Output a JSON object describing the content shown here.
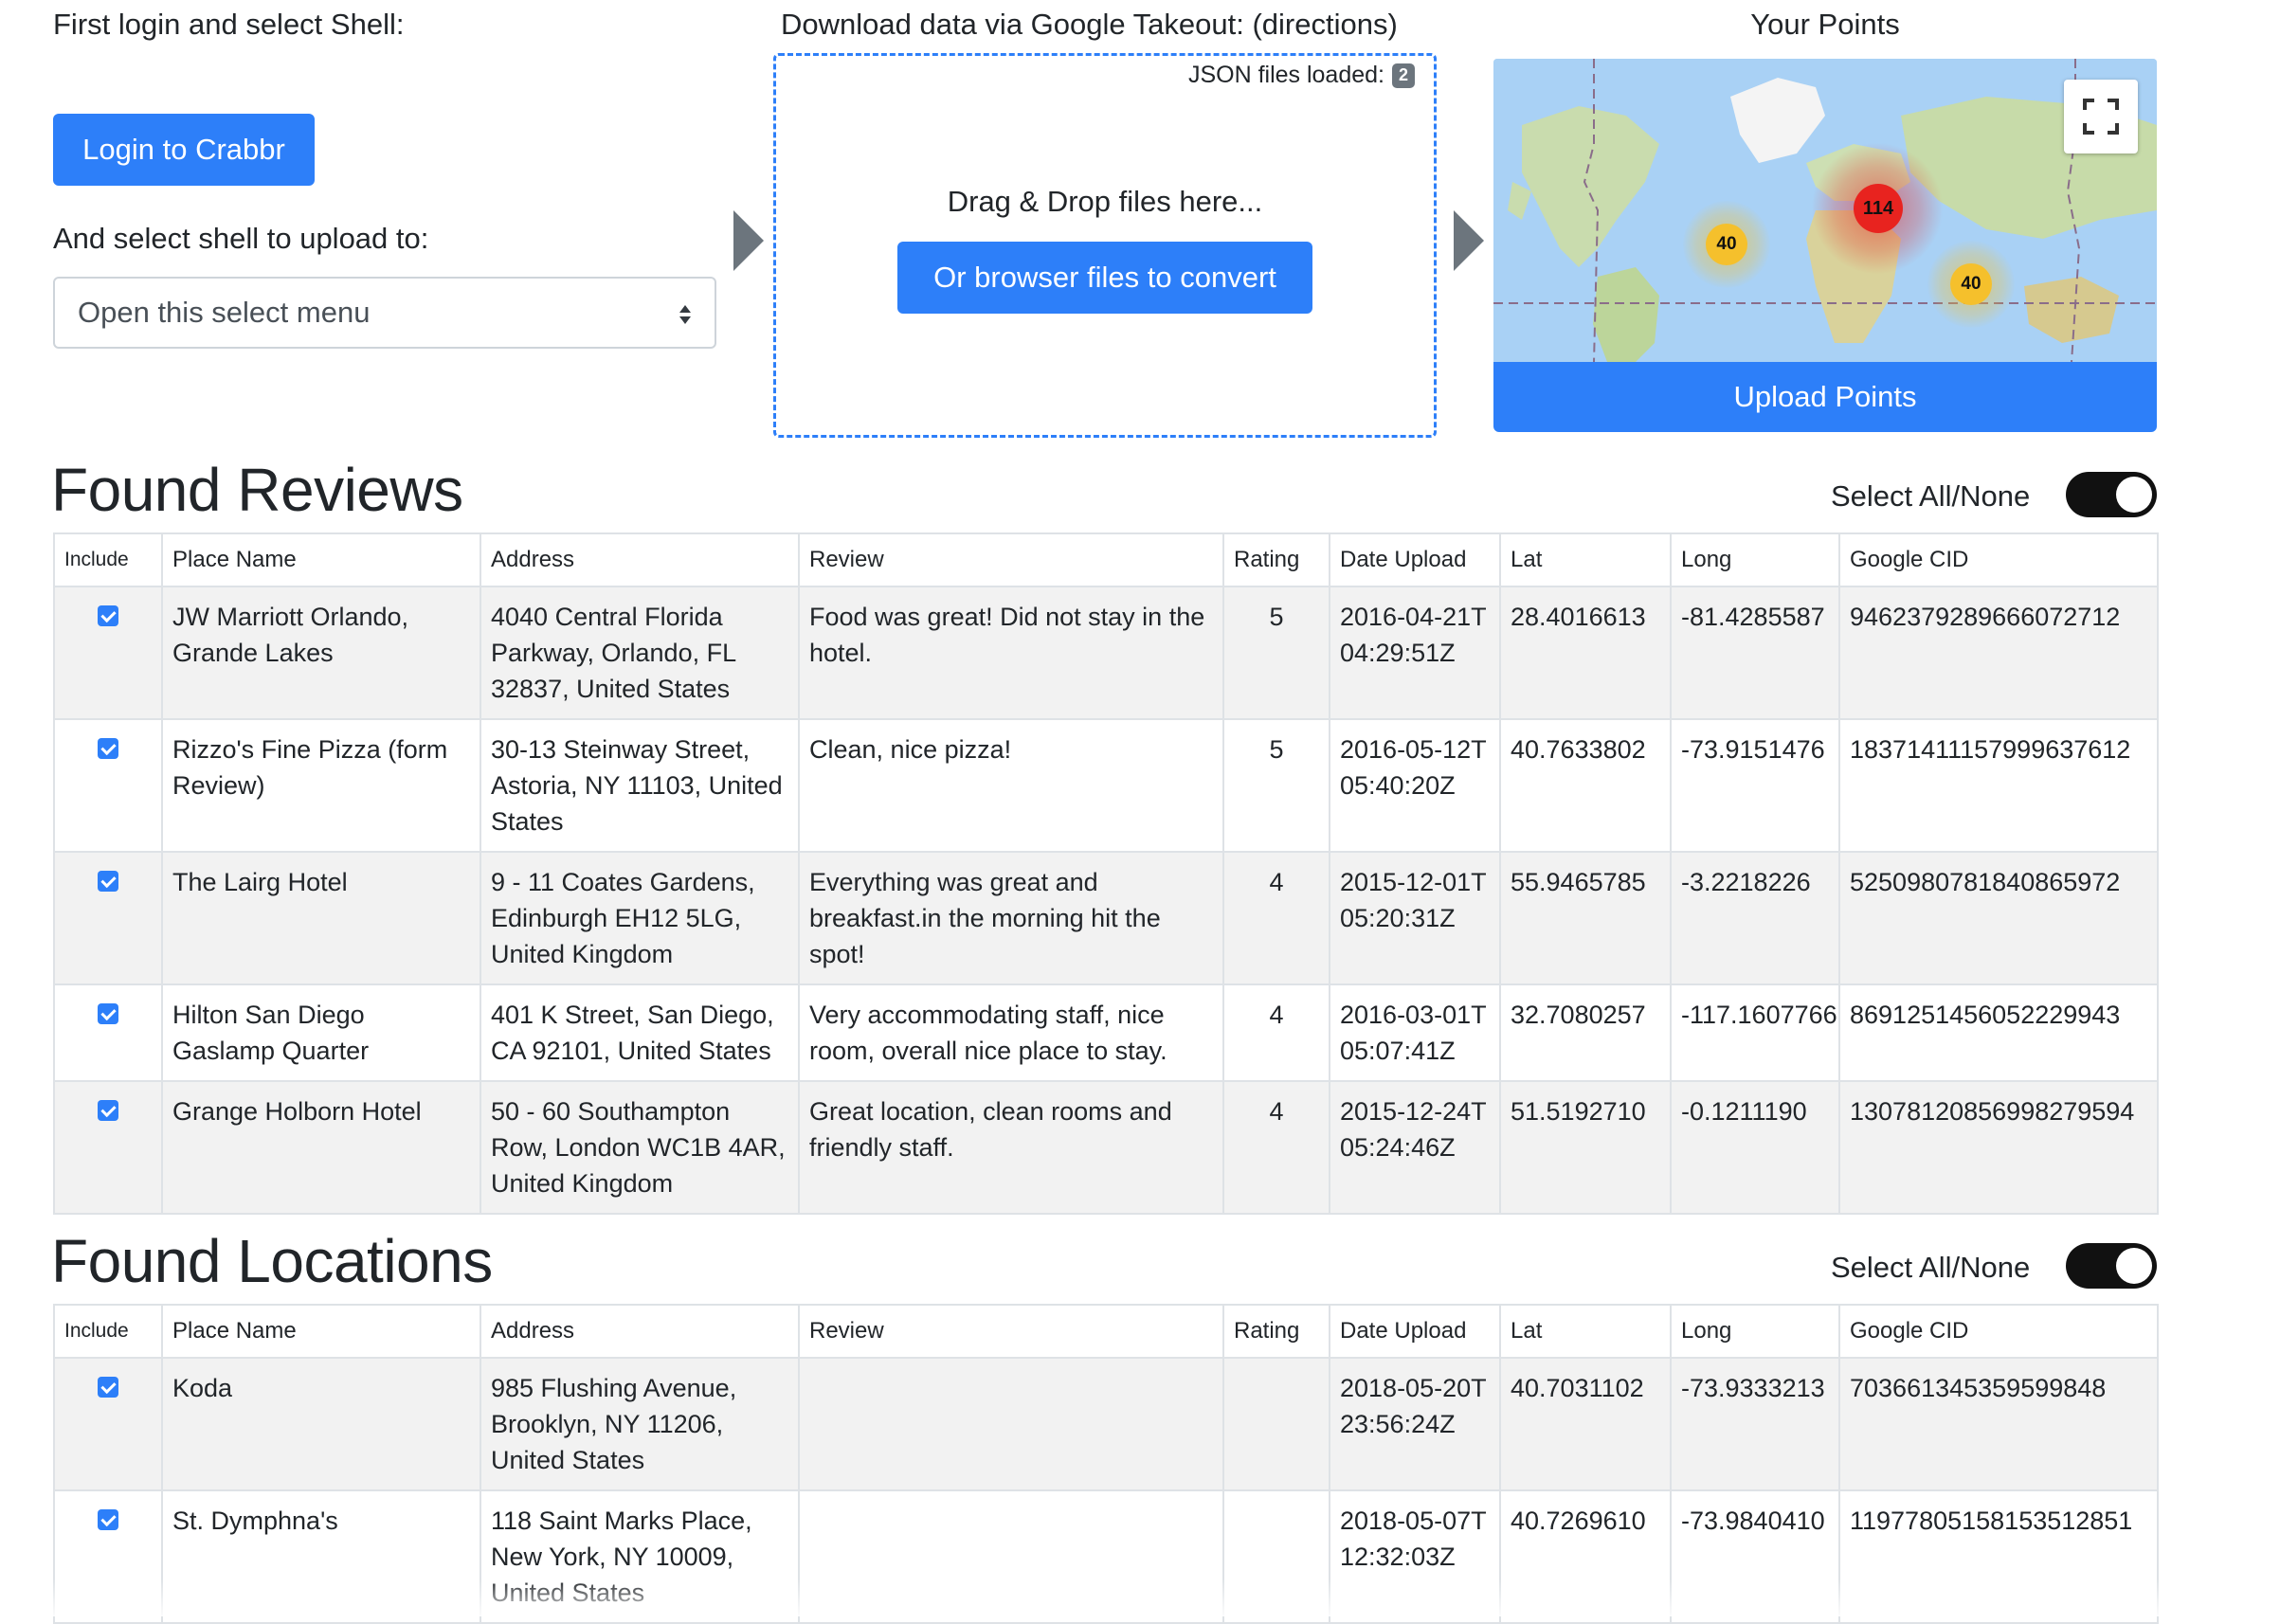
{
  "shell_section": {
    "heading": "First login and select Shell:",
    "login_button": "Login to Crabbr",
    "select_label": "And select shell to upload to:",
    "select_value": "Open this select menu"
  },
  "takeout_section": {
    "heading": "Download data via Google Takeout: (directions)",
    "json_loaded_label": "JSON files loaded:",
    "json_loaded_count": "2",
    "drop_text": "Drag & Drop files here...",
    "browse_button": "Or browser files to convert"
  },
  "points_section": {
    "heading": "Your Points",
    "clusters": [
      {
        "label": "114",
        "color": "#e8231f"
      },
      {
        "label": "40",
        "color": "#f5c02c"
      },
      {
        "label": "40",
        "color": "#f5c02c"
      }
    ],
    "upload_button": "Upload Points"
  },
  "columns": [
    "Include",
    "Place Name",
    "Address",
    "Review",
    "Rating",
    "Date Upload",
    "Lat",
    "Long",
    "Google CID"
  ],
  "reviews": {
    "title": "Found Reviews",
    "toggle_label": "Select All/None",
    "rows": [
      {
        "place": "JW Marriott Orlando, Grande Lakes",
        "address": "4040 Central Florida Parkway, Orlando, FL 32837, United States",
        "review": "Food was great! Did not stay in the hotel.",
        "rating": "5",
        "date": "2016-04-21T04:29:51Z",
        "lat": "28.4016613",
        "long": "-81.4285587",
        "cid": "9462379289666072712"
      },
      {
        "place": "Rizzo's Fine Pizza (form Review)",
        "address": "30-13 Steinway Street, Astoria, NY 11103, United States",
        "review": "Clean, nice pizza!",
        "rating": "5",
        "date": "2016-05-12T05:40:20Z",
        "lat": "40.7633802",
        "long": "-73.9151476",
        "cid": "18371411157999637612"
      },
      {
        "place": "The Lairg Hotel",
        "address": "9 - 11 Coates Gardens, Edinburgh EH12 5LG, United Kingdom",
        "review": "Everything was great and breakfast.in the morning hit the spot!",
        "rating": "4",
        "date": "2015-12-01T05:20:31Z",
        "lat": "55.9465785",
        "long": "-3.2218226",
        "cid": "5250980781840865972"
      },
      {
        "place": "Hilton San Diego Gaslamp Quarter",
        "address": "401 K Street, San Diego, CA 92101, United States",
        "review": "Very accommodating staff, nice room, overall nice place to stay.",
        "rating": "4",
        "date": "2016-03-01T05:07:41Z",
        "lat": "32.7080257",
        "long": "-117.1607766",
        "cid": "8691251456052229943"
      },
      {
        "place": "Grange Holborn Hotel",
        "address": "50 - 60 Southampton Row, London WC1B 4AR, United Kingdom",
        "review": "Great location, clean rooms and friendly staff.",
        "rating": "4",
        "date": "2015-12-24T05:24:46Z",
        "lat": "51.5192710",
        "long": "-0.1211190",
        "cid": "13078120856998279594"
      }
    ]
  },
  "locations": {
    "title": "Found Locations",
    "toggle_label": "Select All/None",
    "rows": [
      {
        "place": "Koda",
        "address": "985 Flushing Avenue, Brooklyn, NY 11206, United States",
        "review": "",
        "rating": "",
        "date": "2018-05-20T23:56:24Z",
        "lat": "40.7031102",
        "long": "-73.9333213",
        "cid": "703661345359599848"
      },
      {
        "place": "St. Dymphna's",
        "address": "118 Saint Marks Place, New York, NY 10009, United States",
        "review": "",
        "rating": "",
        "date": "2018-05-07T12:32:03Z",
        "lat": "40.7269610",
        "long": "-73.9840410",
        "cid": "11977805158153512851"
      }
    ]
  }
}
